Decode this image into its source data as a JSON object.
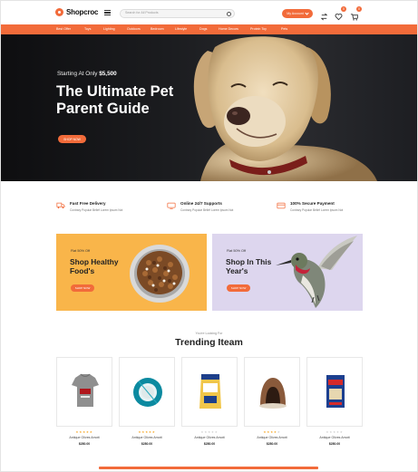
{
  "header": {
    "logo_text": "Shopcroc",
    "search_placeholder": "Search for All Products",
    "account_label": "My Account",
    "wishlist_count": "0",
    "cart_count": "0"
  },
  "nav": {
    "items": [
      "Best Offer",
      "Toys",
      "Lighting",
      "Outdoors",
      "Bedroom",
      "Lifestyle",
      "Dogs",
      "Home Decors",
      "Protein Toy",
      "Pets"
    ]
  },
  "hero": {
    "kicker": "Starting At Only",
    "price": "$5,500",
    "title": "The Ultimate Pet Parent Guide",
    "button": "SHOP NOW"
  },
  "features": [
    {
      "title": "Fast Free Delivery",
      "text": "Contrary Popular Belief Lorem Ipsum Not"
    },
    {
      "title": "Online 24/7 Supports",
      "text": "Contrary Popular Belief Lorem Ipsum Not"
    },
    {
      "title": "100% Secure Payment",
      "text": "Contrary Popular Belief Lorem Ipsum Not"
    }
  ],
  "promos": [
    {
      "kicker": "Flat 50% Off",
      "title": "Shop Healthy Food's",
      "button": "SHOP NOW",
      "bg": "#f9b54a"
    },
    {
      "kicker": "Flat 50% Off",
      "title": "Shop In This Year's",
      "button": "SHOP NOW",
      "bg": "#ddd6ee"
    }
  ],
  "trending": {
    "kicker": "You're Looking For",
    "title": "Trending Iteam",
    "products": [
      {
        "name": "Antique Olives Amott",
        "price": "$280.00",
        "rating": 5,
        "icon": "dog-shirt-icon"
      },
      {
        "name": "Antique Olives Amott",
        "price": "$280.00",
        "rating": 5,
        "icon": "pet-bowl-icon"
      },
      {
        "name": "Antique Olives Amott",
        "price": "$280.00",
        "rating": 0,
        "icon": "food-bag-icon"
      },
      {
        "name": "Antique Olives Amott",
        "price": "$280.00",
        "rating": 4,
        "icon": "pet-bed-icon"
      },
      {
        "name": "Antique Olives Amott",
        "price": "$280.00",
        "rating": 0,
        "icon": "food-box-icon"
      }
    ]
  },
  "colors": {
    "accent": "#f26b3a",
    "star": "#f5a623"
  }
}
